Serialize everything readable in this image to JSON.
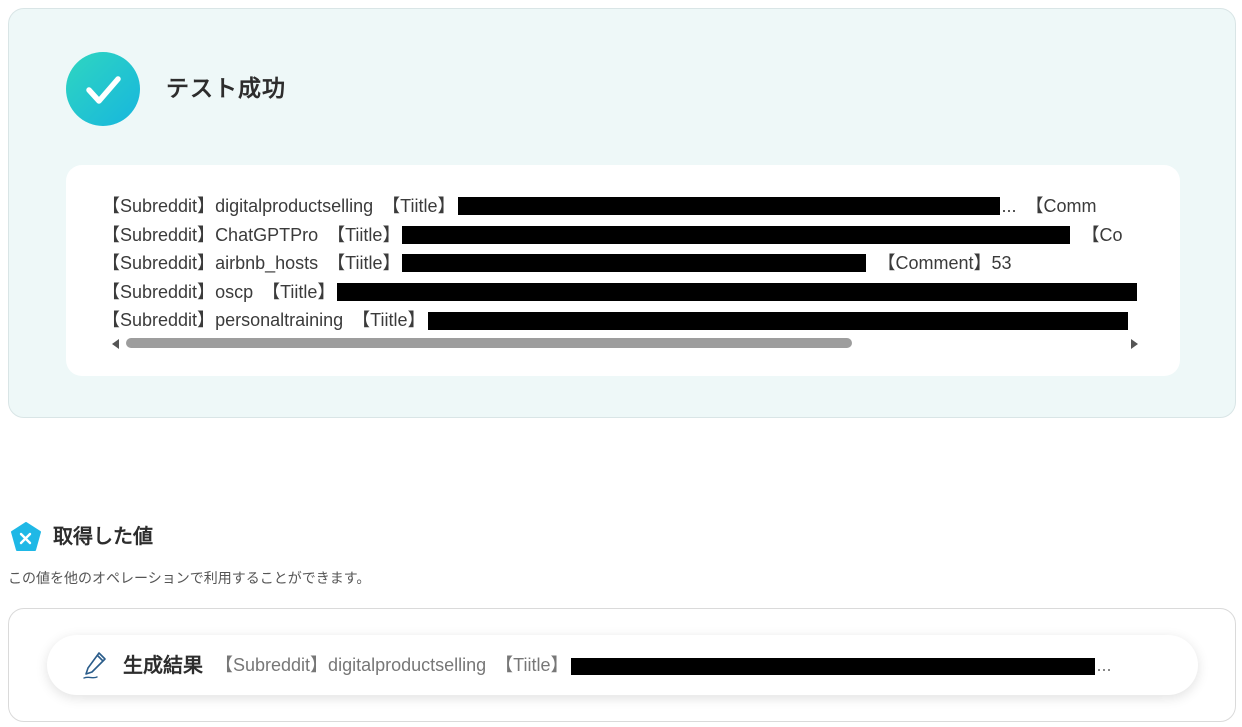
{
  "test_result": {
    "title": "テスト成功",
    "lines": [
      {
        "subreddit_tag": "【Subreddit】",
        "subreddit": "digitalproductselling",
        "title_tag": "【Tiitle】",
        "title_suffix": "...",
        "comment_tag": "【Comm",
        "comment_value": ""
      },
      {
        "subreddit_tag": "【Subreddit】",
        "subreddit": "ChatGPTPro",
        "title_tag": "【Tiitle】",
        "title_suffix": "",
        "comment_tag": "【Co",
        "comment_value": ""
      },
      {
        "subreddit_tag": "【Subreddit】",
        "subreddit": "airbnb_hosts",
        "title_tag": "【Tiitle】",
        "title_suffix": "",
        "comment_tag": "【Comment】",
        "comment_value": "53"
      },
      {
        "subreddit_tag": "【Subreddit】",
        "subreddit": "oscp",
        "title_tag": "【Tiitle】",
        "title_suffix": "",
        "comment_tag": "",
        "comment_value": ""
      },
      {
        "subreddit_tag": "【Subreddit】",
        "subreddit": "personaltraining",
        "title_tag": "【Tiitle】",
        "title_suffix": "",
        "comment_tag": "",
        "comment_value": ""
      }
    ],
    "scroll_progress": 0.7
  },
  "obtained_values": {
    "heading": "取得した値",
    "description": "この値を他のオペレーションで利用することができます。",
    "item": {
      "label": "生成結果",
      "value_prefix": "【Subreddit】digitalproductselling　【Tiitle】",
      "value_suffix": "..."
    }
  },
  "icons": {
    "success": "check-circle-icon",
    "values": "x-pentagon-icon",
    "item": "pen-icon"
  },
  "colors": {
    "panel_bg": "#eef8f8",
    "success_gradient_start": "#2fd6c0",
    "success_gradient_end": "#17b6de",
    "values_icon": "#1fb8e6",
    "redaction": "#000000"
  }
}
